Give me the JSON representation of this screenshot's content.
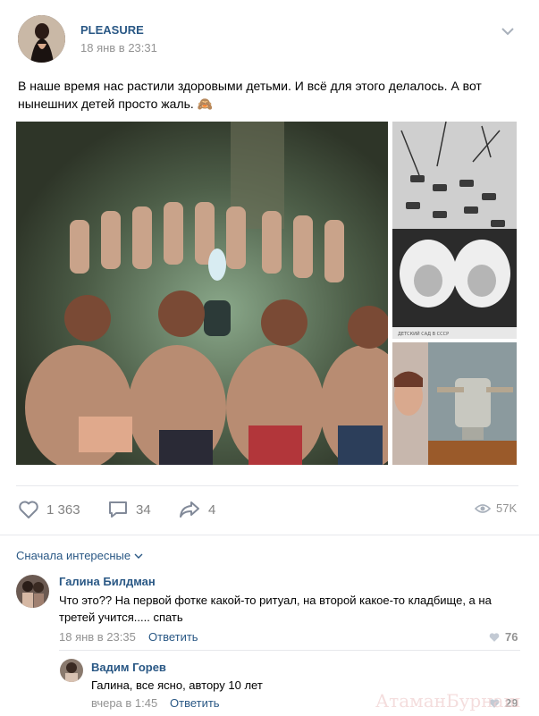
{
  "post": {
    "author": "PLEASURE",
    "time": "18 янв в 23:31",
    "text": "В наше время нас растили здоровыми детьми. И всё для этого делалось. А вот нынешних детей просто жаль. 🙈",
    "photos": [
      {
        "name": "photo-children-uv-lamp"
      },
      {
        "name": "photo-babies-outdoors"
      },
      {
        "name": "photo-child-lamp-device"
      }
    ],
    "photo_caption": "ДЕТСКИЙ САД В СССР"
  },
  "actions": {
    "likes": "1 363",
    "comments": "34",
    "shares": "4",
    "views": "57K"
  },
  "comments_sort": "Сначала интересные",
  "comments": [
    {
      "author": "Галина Билдман",
      "text": "Что это?? На первой фотке какой-то ритуал, на второй какое-то кладбище, а на третей учится..... спать",
      "time": "18 янв в 23:35",
      "reply_label": "Ответить",
      "likes": "76"
    },
    {
      "author": "Вадим Горев",
      "text": "Галина, все ясно, автору 10 лет",
      "time": "вчера в 1:45",
      "reply_label": "Ответить",
      "likes": "29"
    }
  ],
  "watermark": "АтаманБурнаш"
}
